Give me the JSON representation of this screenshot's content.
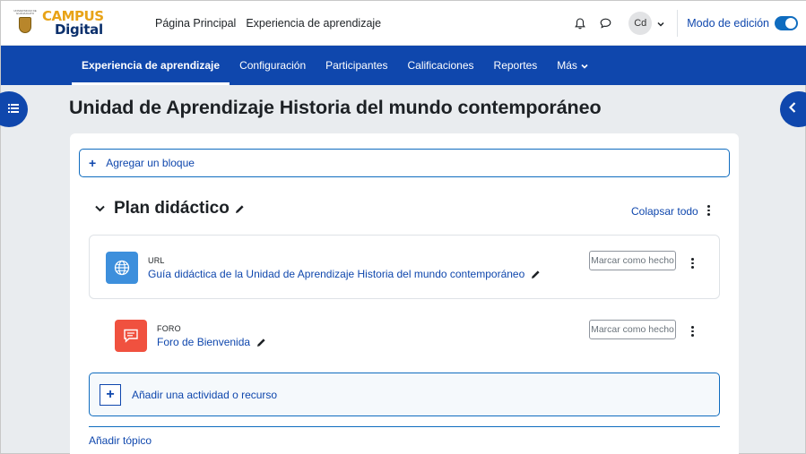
{
  "header": {
    "logo": {
      "seal_text": "UNIVERSIDAD DE GUANAJUATO",
      "brand_top": "CAMPUS",
      "brand_bottom": "Digital"
    },
    "links": [
      "Página Principal",
      "Experiencia de aprendizaje"
    ],
    "icons": [
      "bell-icon",
      "chat-icon"
    ],
    "avatar_initials": "Cd",
    "edit_mode_label": "Modo de edición",
    "edit_mode_on": true
  },
  "secondary_nav": {
    "items": [
      "Experiencia de aprendizaje",
      "Configuración",
      "Participantes",
      "Calificaciones",
      "Reportes",
      "Más"
    ],
    "active_index": 0
  },
  "page": {
    "title": "Unidad de Aprendizaje Historia del mundo contemporáneo",
    "add_block_label": "Agregar un bloque",
    "section": {
      "title": "Plan didáctico",
      "collapse_all_label": "Colapsar todo",
      "activities": [
        {
          "type": "URL",
          "name": "Guía didáctica de la Unidad de Aprendizaje Historia del mundo contemporáneo",
          "icon": "globe-icon",
          "mark_label": "Marcar como hecho"
        },
        {
          "type": "FORO",
          "name": "Foro de Bienvenida",
          "icon": "forum-icon",
          "mark_label": "Marcar como hecho"
        }
      ],
      "add_activity_label": "Añadir una actividad o recurso"
    },
    "add_topic_label": "Añadir tópico"
  },
  "colors": {
    "primary": "#0f47ad",
    "url_icon_bg": "#3d8fdc",
    "forum_icon_bg": "#f0513f",
    "brand_orange": "#e8a317",
    "brand_navy": "#0a2f6b"
  }
}
